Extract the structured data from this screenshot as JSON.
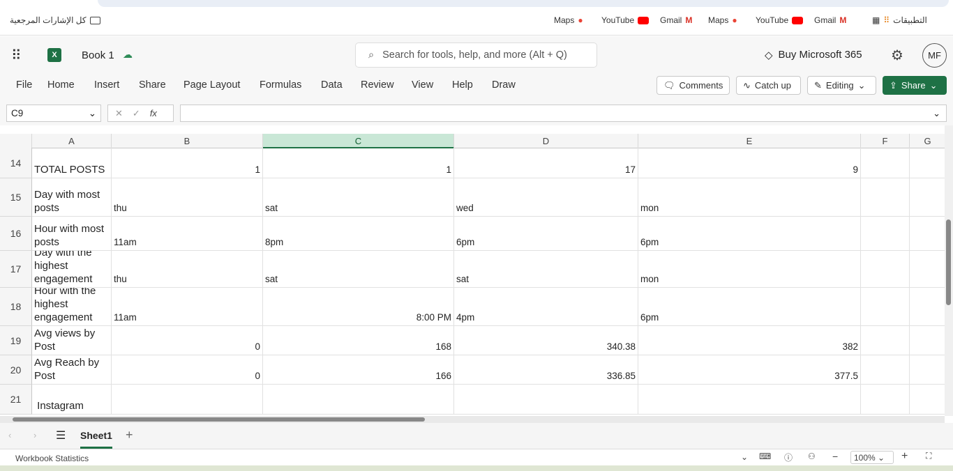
{
  "bookmarks": {
    "all_label": "كل الإشارات المرجعية",
    "items": [
      "Maps",
      "YouTube",
      "Gmail",
      "Maps",
      "YouTube",
      "Gmail"
    ],
    "apps_label": "التطبيقات"
  },
  "app": {
    "title": "Book 1",
    "search_placeholder": "Search for tools, help, and more (Alt + Q)",
    "buy_label": "Buy Microsoft 365",
    "avatar": "MF",
    "accent": "#1e7145"
  },
  "menu": [
    "File",
    "Home",
    "Insert",
    "Share",
    "Page Layout",
    "Formulas",
    "Data",
    "Review",
    "View",
    "Help",
    "Draw"
  ],
  "actions": {
    "comments": "Comments",
    "catchup": "Catch up",
    "editing": "Editing",
    "share": "Share"
  },
  "formula": {
    "name_box": "C9",
    "fx": "fx",
    "value": ""
  },
  "columns": [
    "A",
    "B",
    "C",
    "D",
    "E",
    "F",
    "G"
  ],
  "selected_column": "C",
  "rows": [
    {
      "num": "14",
      "cells": [
        "TOTAL POSTS",
        "1",
        "1",
        "17",
        "9"
      ]
    },
    {
      "num": "15",
      "cells": [
        "Day with most\nposts",
        "thu",
        "sat",
        "wed",
        "mon"
      ]
    },
    {
      "num": "16",
      "cells": [
        "Hour with most\nposts",
        "11am",
        "8pm",
        "6pm",
        "6pm"
      ]
    },
    {
      "num": "17",
      "cells": [
        "Day with the\nhighest\nengagement",
        "thu",
        "sat",
        "sat",
        "mon"
      ]
    },
    {
      "num": "18",
      "cells": [
        "Hour with the\nhighest\nengagement",
        "11am",
        "8:00 PM",
        "4pm",
        "6pm"
      ]
    },
    {
      "num": "19",
      "cells": [
        "Avg views by\nPost",
        "0",
        "168",
        "340.38",
        "382"
      ]
    },
    {
      "num": "20",
      "cells": [
        "Avg Reach by\nPost",
        "0",
        "166",
        "336.85",
        "377.5"
      ]
    },
    {
      "num": "21",
      "cells": [
        " Instagram",
        "",
        "",
        "",
        ""
      ]
    }
  ],
  "sheets": {
    "active": "Sheet1"
  },
  "status": {
    "left": "Workbook Statistics",
    "zoom": "100%"
  }
}
